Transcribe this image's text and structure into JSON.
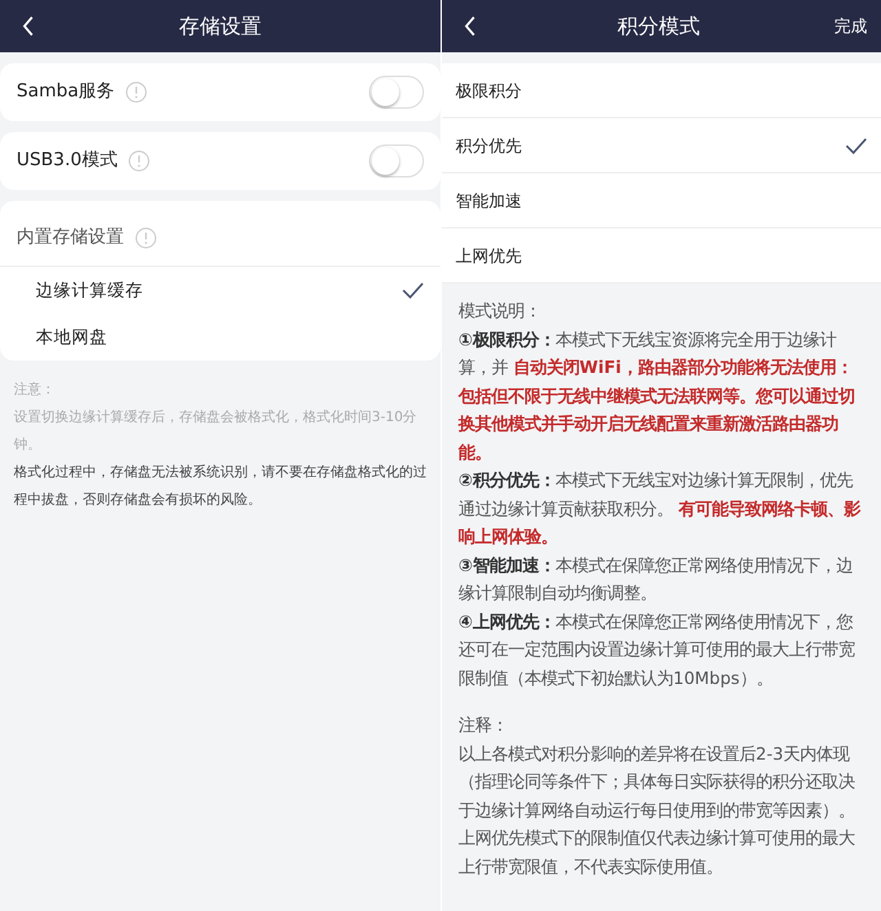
{
  "left": {
    "title": "存储设置",
    "toggles": [
      {
        "label": "Samba服务",
        "on": false
      },
      {
        "label": "USB3.0模式",
        "on": false
      }
    ],
    "storage": {
      "label": "内置存储设置",
      "options": [
        {
          "label": "边缘计算缓存",
          "selected": true
        },
        {
          "label": "本地网盘",
          "selected": false
        }
      ]
    },
    "notes": [
      {
        "kind": "muted",
        "text": "注意："
      },
      {
        "kind": "muted",
        "text": "设置切换边缘计算缓存后，存储盘会被格式化，格式化时间3-10分钟。"
      },
      {
        "kind": "normal",
        "text": "格式化过程中，存储盘无法被系统识别，请不要在存储盘格式化的过程中拔盘，否则存储盘会有损坏的风险。"
      }
    ]
  },
  "right": {
    "title": "积分模式",
    "done": "完成",
    "modes": [
      {
        "label": "极限积分",
        "selected": false
      },
      {
        "label": "积分优先",
        "selected": true
      },
      {
        "label": "智能加速",
        "selected": false
      },
      {
        "label": "上网优先",
        "selected": false
      }
    ],
    "description": [
      {
        "kind": "heading",
        "segments": [
          {
            "kind": "normal",
            "text": "模式说明："
          }
        ]
      },
      {
        "kind": "item",
        "segments": [
          {
            "kind": "bold",
            "text": "①极限积分："
          },
          {
            "kind": "normal",
            "text": "本模式下无线宝资源将完全用于边缘计算，并 "
          },
          {
            "kind": "red",
            "text": "自动关闭WiFi，路由器部分功能将无法使用：包括但不限于无线中继模式无法联网等。您可以通过切换其他模式并手动开启无线配置来重新激活路由器功能。"
          }
        ]
      },
      {
        "kind": "item",
        "segments": [
          {
            "kind": "bold",
            "text": "②积分优先："
          },
          {
            "kind": "normal",
            "text": "本模式下无线宝对边缘计算无限制，优先通过边缘计算贡献获取积分。 "
          },
          {
            "kind": "red",
            "text": "有可能导致网络卡顿、影响上网体验。"
          }
        ]
      },
      {
        "kind": "item",
        "segments": [
          {
            "kind": "bold",
            "text": "③智能加速："
          },
          {
            "kind": "normal",
            "text": "本模式在保障您正常网络使用情况下，边缘计算限制自动均衡调整。"
          }
        ]
      },
      {
        "kind": "item",
        "segments": [
          {
            "kind": "bold",
            "text": "④上网优先："
          },
          {
            "kind": "normal",
            "text": "本模式在保障您正常网络使用情况下，您还可在一定范围内设置边缘计算可使用的最大上行带宽限制值（本模式下初始默认为10Mbps）。"
          }
        ]
      },
      {
        "kind": "heading",
        "segments": [
          {
            "kind": "normal",
            "text": "注释："
          }
        ]
      },
      {
        "kind": "item",
        "segments": [
          {
            "kind": "normal",
            "text": "以上各模式对积分影响的差异将在设置后2-3天内体现（指理论同等条件下；具体每日实际获得的积分还取决于边缘计算网络自动运行每日使用到的带宽等因素）。上网优先模式下的限制值仅代表边缘计算可使用的最大上行带宽限值，不代表实际使用值。"
          }
        ]
      }
    ]
  }
}
